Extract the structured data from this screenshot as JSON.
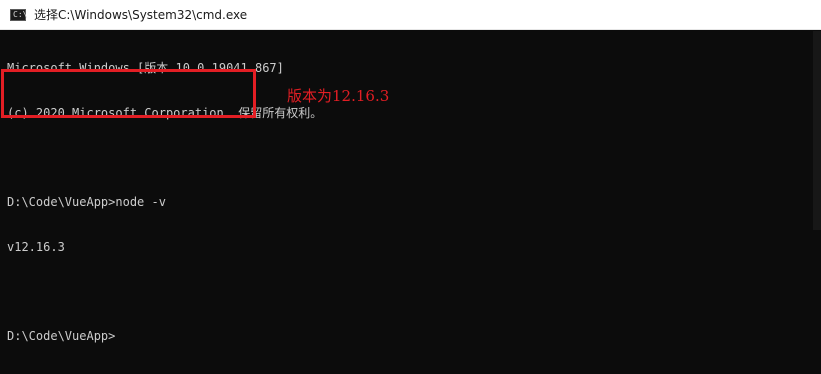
{
  "window": {
    "title": "选择C:\\Windows\\System32\\cmd.exe",
    "icon": "cmd-console-icon",
    "icon_glyph": "C:\\"
  },
  "console": {
    "header_line_1": "Microsoft Windows [版本 10.0.19041.867]",
    "header_line_2": "(c) 2020 Microsoft Corporation. 保留所有权利。",
    "command_line": "D:\\Code\\VueApp>node -v",
    "output_line": "v12.16.3",
    "prompt_line": "D:\\Code\\VueApp>"
  },
  "annotation": {
    "text": "版本为12.16.3",
    "color": "#e31e24"
  },
  "colors": {
    "console_background": "#0c0c0c",
    "console_text": "#cccccc",
    "highlight_border": "#e31e24"
  }
}
